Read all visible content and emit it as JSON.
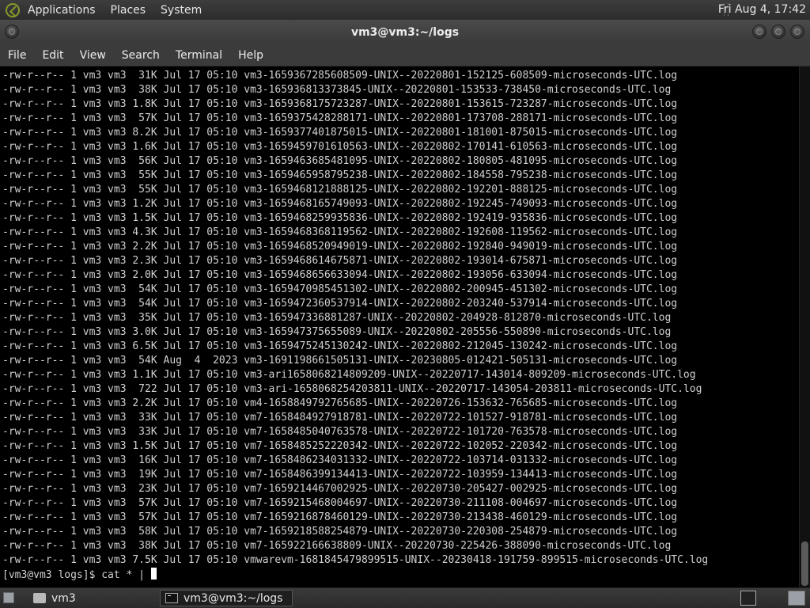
{
  "top_panel": {
    "menus": [
      "Applications",
      "Places",
      "System"
    ],
    "clock": "Fri Aug  4, 17:42"
  },
  "window": {
    "title": "vm3@vm3:~/logs"
  },
  "menubar": {
    "items": [
      "File",
      "Edit",
      "View",
      "Search",
      "Terminal",
      "Help"
    ]
  },
  "terminal": {
    "lines": [
      "-rw-r--r-- 1 vm3 vm3  31K Jul 17 05:10 vm3-1659367285608509-UNIX--20220801-152125-608509-microseconds-UTC.log",
      "-rw-r--r-- 1 vm3 vm3  38K Jul 17 05:10 vm3-165936813373845-UNIX--20220801-153533-738450-microseconds-UTC.log",
      "-rw-r--r-- 1 vm3 vm3 1.8K Jul 17 05:10 vm3-1659368175723287-UNIX--20220801-153615-723287-microseconds-UTC.log",
      "-rw-r--r-- 1 vm3 vm3  57K Jul 17 05:10 vm3-1659375428288171-UNIX--20220801-173708-288171-microseconds-UTC.log",
      "-rw-r--r-- 1 vm3 vm3 8.2K Jul 17 05:10 vm3-1659377401875015-UNIX--20220801-181001-875015-microseconds-UTC.log",
      "-rw-r--r-- 1 vm3 vm3 1.6K Jul 17 05:10 vm3-1659459701610563-UNIX--20220802-170141-610563-microseconds-UTC.log",
      "-rw-r--r-- 1 vm3 vm3  56K Jul 17 05:10 vm3-1659463685481095-UNIX--20220802-180805-481095-microseconds-UTC.log",
      "-rw-r--r-- 1 vm3 vm3  55K Jul 17 05:10 vm3-1659465958795238-UNIX--20220802-184558-795238-microseconds-UTC.log",
      "-rw-r--r-- 1 vm3 vm3  55K Jul 17 05:10 vm3-1659468121888125-UNIX--20220802-192201-888125-microseconds-UTC.log",
      "-rw-r--r-- 1 vm3 vm3 1.2K Jul 17 05:10 vm3-1659468165749093-UNIX--20220802-192245-749093-microseconds-UTC.log",
      "-rw-r--r-- 1 vm3 vm3 1.5K Jul 17 05:10 vm3-1659468259935836-UNIX--20220802-192419-935836-microseconds-UTC.log",
      "-rw-r--r-- 1 vm3 vm3 4.3K Jul 17 05:10 vm3-1659468368119562-UNIX--20220802-192608-119562-microseconds-UTC.log",
      "-rw-r--r-- 1 vm3 vm3 2.2K Jul 17 05:10 vm3-1659468520949019-UNIX--20220802-192840-949019-microseconds-UTC.log",
      "-rw-r--r-- 1 vm3 vm3 2.3K Jul 17 05:10 vm3-1659468614675871-UNIX--20220802-193014-675871-microseconds-UTC.log",
      "-rw-r--r-- 1 vm3 vm3 2.0K Jul 17 05:10 vm3-1659468656633094-UNIX--20220802-193056-633094-microseconds-UTC.log",
      "-rw-r--r-- 1 vm3 vm3  54K Jul 17 05:10 vm3-1659470985451302-UNIX--20220802-200945-451302-microseconds-UTC.log",
      "-rw-r--r-- 1 vm3 vm3  54K Jul 17 05:10 vm3-1659472360537914-UNIX--20220802-203240-537914-microseconds-UTC.log",
      "-rw-r--r-- 1 vm3 vm3  35K Jul 17 05:10 vm3-165947336881287-UNIX--20220802-204928-812870-microseconds-UTC.log",
      "-rw-r--r-- 1 vm3 vm3 3.0K Jul 17 05:10 vm3-165947375655089-UNIX--20220802-205556-550890-microseconds-UTC.log",
      "-rw-r--r-- 1 vm3 vm3 6.5K Jul 17 05:10 vm3-1659475245130242-UNIX--20220802-212045-130242-microseconds-UTC.log",
      "-rw-r--r-- 1 vm3 vm3  54K Aug  4  2023 vm3-1691198661505131-UNIX--20230805-012421-505131-microseconds-UTC.log",
      "-rw-r--r-- 1 vm3 vm3 1.1K Jul 17 05:10 vm3-ari1658068214809209-UNIX--20220717-143014-809209-microseconds-UTC.log",
      "-rw-r--r-- 1 vm3 vm3  722 Jul 17 05:10 vm3-ari-1658068254203811-UNIX--20220717-143054-203811-microseconds-UTC.log",
      "-rw-r--r-- 1 vm3 vm3 2.2K Jul 17 05:10 vm4-1658849792765685-UNIX--20220726-153632-765685-microseconds-UTC.log",
      "-rw-r--r-- 1 vm3 vm3  33K Jul 17 05:10 vm7-1658484927918781-UNIX--20220722-101527-918781-microseconds-UTC.log",
      "-rw-r--r-- 1 vm3 vm3  33K Jul 17 05:10 vm7-1658485040763578-UNIX--20220722-101720-763578-microseconds-UTC.log",
      "-rw-r--r-- 1 vm3 vm3 1.5K Jul 17 05:10 vm7-1658485252220342-UNIX--20220722-102052-220342-microseconds-UTC.log",
      "-rw-r--r-- 1 vm3 vm3  16K Jul 17 05:10 vm7-1658486234031332-UNIX--20220722-103714-031332-microseconds-UTC.log",
      "-rw-r--r-- 1 vm3 vm3  19K Jul 17 05:10 vm7-1658486399134413-UNIX--20220722-103959-134413-microseconds-UTC.log",
      "-rw-r--r-- 1 vm3 vm3  23K Jul 17 05:10 vm7-1659214467002925-UNIX--20220730-205427-002925-microseconds-UTC.log",
      "-rw-r--r-- 1 vm3 vm3  57K Jul 17 05:10 vm7-1659215468004697-UNIX--20220730-211108-004697-microseconds-UTC.log",
      "-rw-r--r-- 1 vm3 vm3  57K Jul 17 05:10 vm7-1659216878460129-UNIX--20220730-213438-460129-microseconds-UTC.log",
      "-rw-r--r-- 1 vm3 vm3  58K Jul 17 05:10 vm7-1659218588254879-UNIX--20220730-220308-254879-microseconds-UTC.log",
      "-rw-r--r-- 1 vm3 vm3  38K Jul 17 05:10 vm7-165922166638809-UNIX--20220730-225426-388090-microseconds-UTC.log",
      "-rw-r--r-- 1 vm3 vm3 7.5K Jul 17 05:10 vmwarevm-1681845479899515-UNIX--20230418-191759-899515-microseconds-UTC.log"
    ],
    "prompt": "[vm3@vm3 logs]$ cat * | "
  },
  "taskbar": {
    "tasks": [
      {
        "label": "vm3",
        "icon": "folder-icon"
      },
      {
        "label": "vm3@vm3:~/logs",
        "icon": "terminal-icon"
      }
    ]
  },
  "colors": {
    "terminal_bg": "#000000",
    "terminal_fg": "#d0d0d0",
    "panel_bg": "#333333"
  }
}
